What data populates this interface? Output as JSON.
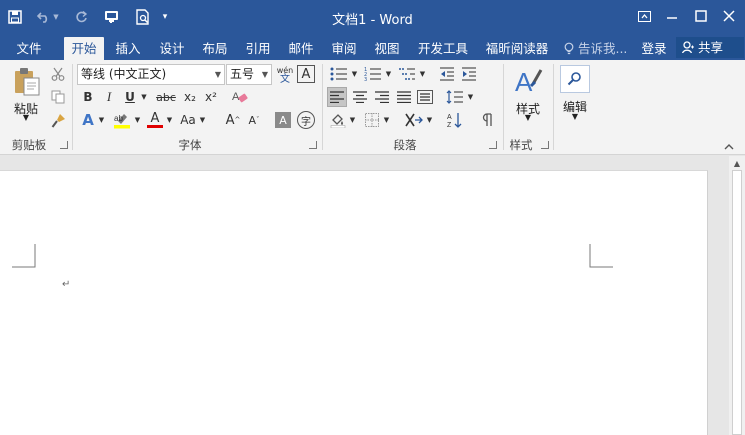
{
  "window": {
    "title": "文档1 - Word",
    "colors": {
      "brand": "#2b579a",
      "ribbon_bg": "#f3f3f3",
      "page_bg": "#ffffff"
    }
  },
  "quick_access": {
    "icons": [
      "save-icon",
      "undo-icon",
      "redo-icon",
      "touch-mode-icon",
      "print-preview-icon",
      "customize-icon"
    ]
  },
  "window_controls": {
    "icons": [
      "ribbon-display-icon",
      "minimize-icon",
      "maximize-icon",
      "close-icon"
    ]
  },
  "tabs": [
    {
      "label": "文件",
      "active": false
    },
    {
      "label": "开始",
      "active": true
    },
    {
      "label": "插入",
      "active": false
    },
    {
      "label": "设计",
      "active": false
    },
    {
      "label": "布局",
      "active": false
    },
    {
      "label": "引用",
      "active": false
    },
    {
      "label": "邮件",
      "active": false
    },
    {
      "label": "审阅",
      "active": false
    },
    {
      "label": "视图",
      "active": false
    },
    {
      "label": "开发工具",
      "active": false
    },
    {
      "label": "福昕阅读器",
      "active": false
    }
  ],
  "tell_me": {
    "placeholder": "告诉我..."
  },
  "account": {
    "signin": "登录",
    "share": "共享"
  },
  "ribbon": {
    "clipboard": {
      "label": "剪贴板",
      "paste": "粘贴"
    },
    "font": {
      "label": "字体",
      "font_name": "等线 (中文正文)",
      "font_size": "五号",
      "bold": "B",
      "italic": "I",
      "underline": "U",
      "strike": "abc",
      "subscript": "x₂",
      "superscript": "x²",
      "text_effects": "A",
      "font_color": "A",
      "change_case": "Aa",
      "grow": "A",
      "shrink": "A",
      "char_shading": "A",
      "enclose": "字",
      "phonetic_top": "wén",
      "phonetic_bottom": "文",
      "char_border": "A"
    },
    "paragraph": {
      "label": "段落"
    },
    "styles": {
      "label": "样式",
      "button": "样式"
    },
    "editing": {
      "button": "编辑"
    }
  },
  "document": {
    "paragraph_mark": "↵"
  }
}
